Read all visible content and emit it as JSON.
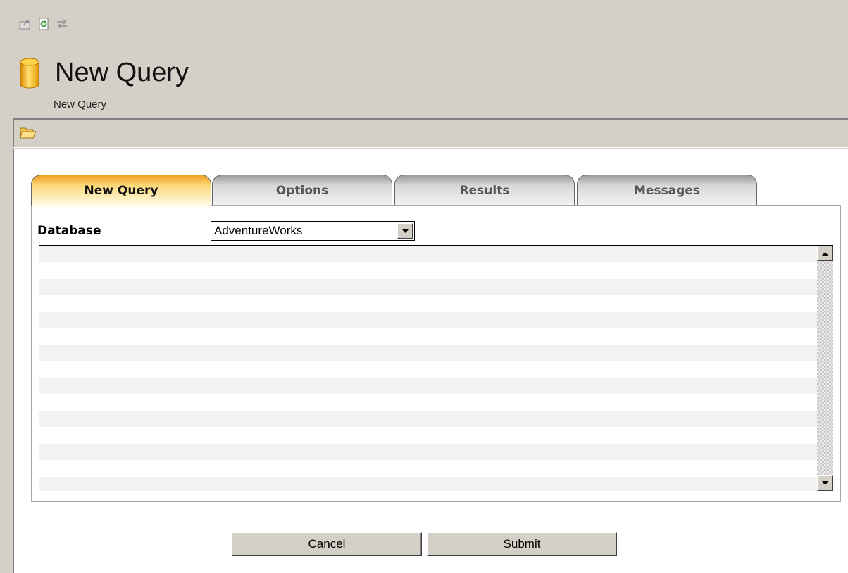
{
  "toolbar_icons": [
    "export-icon",
    "refresh-icon",
    "swap-icon"
  ],
  "header": {
    "title": "New Query",
    "subtitle": "New Query"
  },
  "tabs": [
    {
      "label": "New Query",
      "active": true
    },
    {
      "label": "Options",
      "active": false
    },
    {
      "label": "Results",
      "active": false
    },
    {
      "label": "Messages",
      "active": false
    }
  ],
  "query_form": {
    "database_label": "Database",
    "database_value": "AdventureWorks",
    "query_text": ""
  },
  "buttons": {
    "cancel": "Cancel",
    "submit": "Submit"
  },
  "colors": {
    "window_bg": "#d4d0c8",
    "active_tab": "#fbd97c",
    "inactive_tab": "#d9d9d9"
  }
}
